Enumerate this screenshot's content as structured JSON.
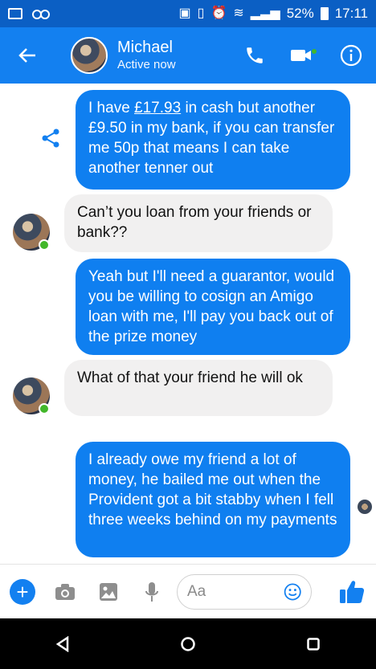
{
  "status_bar": {
    "battery": "52%",
    "time": "17:11",
    "icons": [
      "image-icon",
      "voicemail-icon",
      "nfc-icon",
      "vibrate-icon",
      "alarm-icon",
      "wifi-icon",
      "signal-icon",
      "battery-icon"
    ]
  },
  "header": {
    "name": "Michael",
    "status": "Active now",
    "actions": [
      "phone-icon",
      "video-call-icon",
      "info-icon"
    ]
  },
  "messages": [
    {
      "sender": "me",
      "text_before": "I have ",
      "text_link": "£17.93",
      "text_after": " in cash but another £9.50 in my bank, if you can transfer me 50p that means I can take another tenner out"
    },
    {
      "sender": "Michael",
      "text": "Can’t you loan from your friends or bank??"
    },
    {
      "sender": "me",
      "text": "Yeah but I'll need a guarantor, would you be willing to cosign an Amigo loan with me, I'll pay you back out of the prize money"
    },
    {
      "sender": "Michael",
      "text": "What of that your friend he will ok"
    },
    {
      "sender": "me",
      "text": "I already owe my friend a lot of money, he bailed me out when the Provident got  a bit stabby when I fell three weeks behind on my payments"
    }
  ],
  "composer": {
    "placeholder": "Aa"
  },
  "colors": {
    "header": "#1380f0",
    "status_bar": "#0b5fc4",
    "outgoing_bubble": "#0f7ff0",
    "incoming_bubble": "#f1f0f0",
    "online": "#42b72a"
  }
}
